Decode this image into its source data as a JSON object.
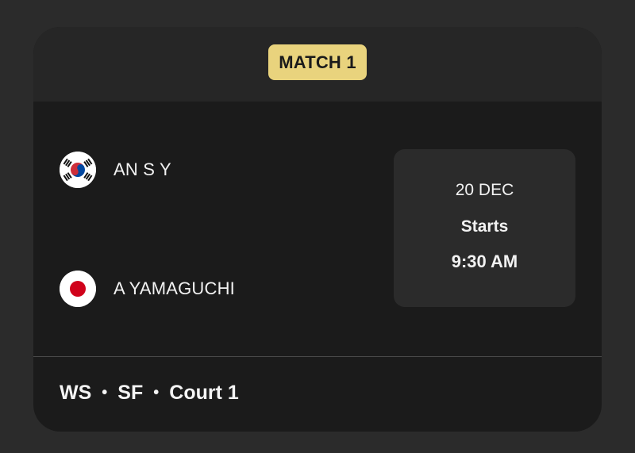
{
  "match": {
    "badge_label": "MATCH 1"
  },
  "players": [
    {
      "name": "AN S Y",
      "flag_icon": "south-korea-flag-icon"
    },
    {
      "name": "A YAMAGUCHI",
      "flag_icon": "japan-flag-icon"
    }
  ],
  "schedule": {
    "date": "20 DEC",
    "starts_label": "Starts",
    "time": "9:30 AM"
  },
  "footer": {
    "event": "WS",
    "separator": "•",
    "round": "SF",
    "court": "Court 1"
  },
  "colors": {
    "page_background": "#2b2b2b",
    "card_background": "#1b1b1b",
    "header_background": "#262626",
    "badge_background": "#e9d37d",
    "time_box_background": "#2b2b2b",
    "text": "#f2f2f2"
  }
}
